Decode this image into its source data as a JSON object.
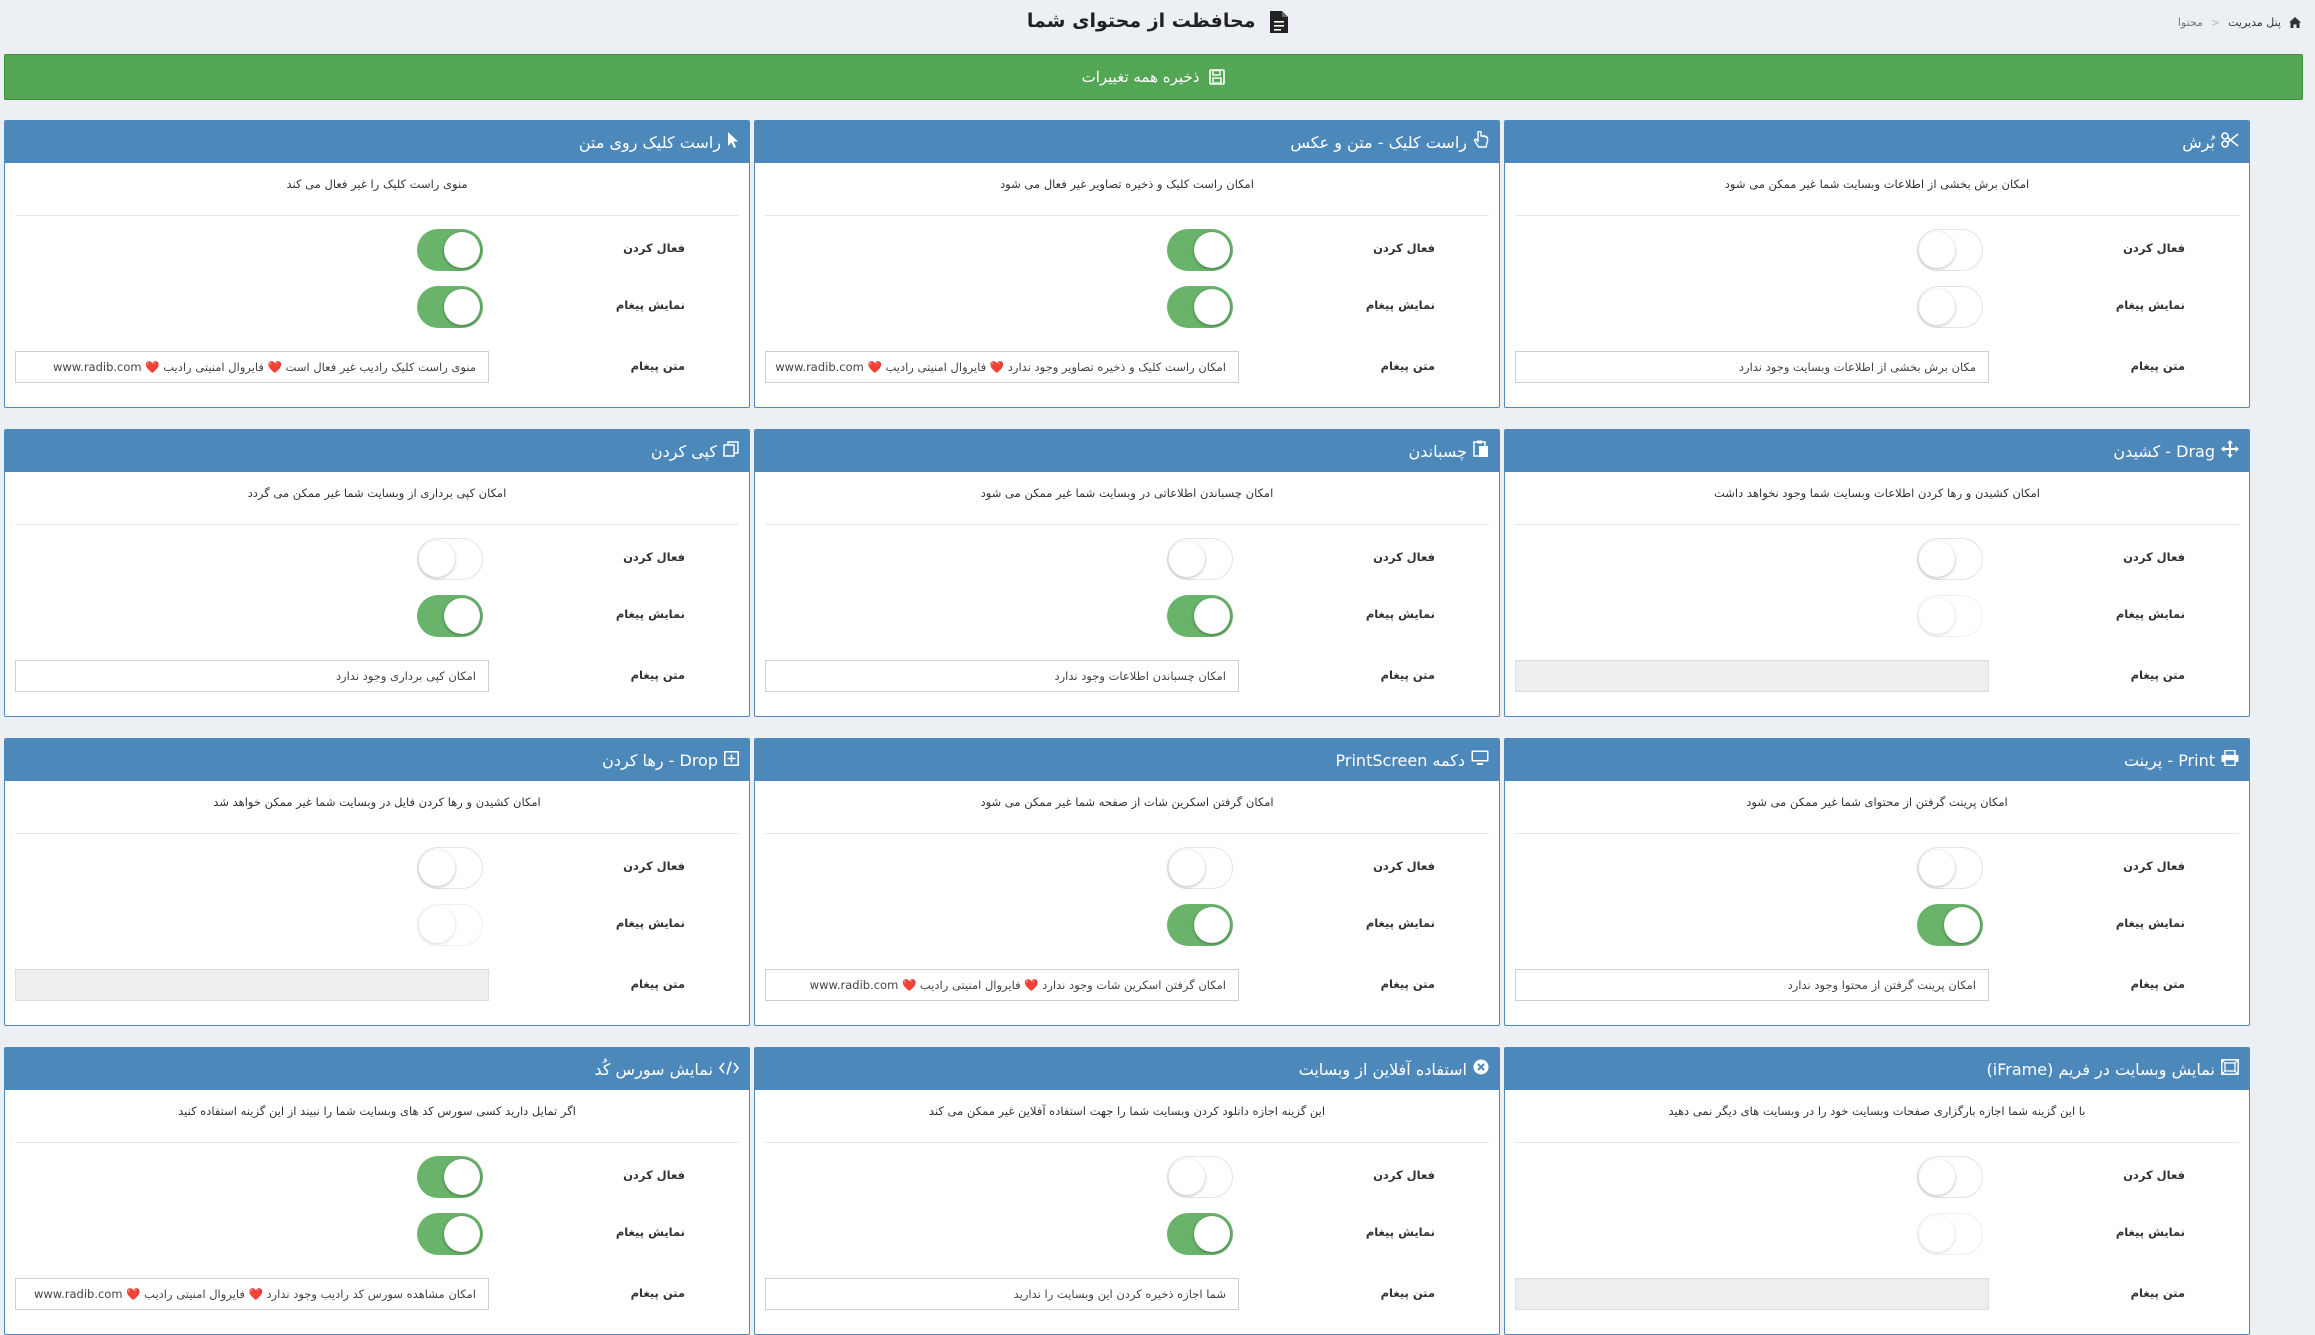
{
  "breadcrumb": {
    "home": "پنل مدیریت",
    "current": "محتوا"
  },
  "page_title": "محافظت از محتوای شما",
  "save_button": "ذخیره همه تغییرات",
  "labels": {
    "enable": "فعال کردن",
    "show_message": "نمایش پیغام",
    "message_text": "متن پیغام"
  },
  "colors": {
    "header": "#4d88bb",
    "save": "#53a653",
    "toggle_on": "#69b36b"
  },
  "cards": [
    {
      "title": "بُرش",
      "icon": "scissors-icon",
      "desc": "امکان برش بخشی از اطلاعات وبسایت شما غیر ممکن می شود",
      "enable": false,
      "show": false,
      "message": "مکان برش بخشی از اطلاعات وبسایت وجود ندارد",
      "disabled": false
    },
    {
      "title": "راست کلیک - متن و عکس",
      "icon": "hand-pointer-icon",
      "desc": "امکان راست کلیک و ذخیره تصاویر غیر فعال می شود",
      "enable": true,
      "show": true,
      "message": "امکان راست کلیک و ذخیره تصاویر وجود ندارد ❤️ فایروال امنیتی رادیب ❤️ www.radib.com",
      "disabled": false
    },
    {
      "title": "راست کلیک روی متن",
      "icon": "cursor-icon",
      "desc": "منوی راست کلیک را غیر فعال می کند",
      "enable": true,
      "show": true,
      "message": "منوی راست کلیک رادیب غیر فعال است ❤️ فایروال امنیتی رادیب ❤️ www.radib.com",
      "disabled": false
    },
    {
      "title": "Drag - کشیدن",
      "icon": "move-icon",
      "desc": "امکان کشیدن و رها کردن اطلاعات وبسایت شما وجود نخواهد داشت",
      "enable": false,
      "show": false,
      "message": "",
      "disabled": true
    },
    {
      "title": "چسباندن",
      "icon": "paste-icon",
      "desc": "امکان چسباندن اطلاعاتی در وبسایت شما غیر ممکن می شود",
      "enable": false,
      "show": true,
      "message": "امکان چسباندن اطلاعات وجود ندارد",
      "disabled": false
    },
    {
      "title": "کپی کردن",
      "icon": "copy-icon",
      "desc": "امکان کپی برداری از وبسایت شما غیر ممکن می گردد",
      "enable": false,
      "show": true,
      "message": "امکان کپی برداری وجود ندارد",
      "disabled": false
    },
    {
      "title": "Print - پرینت",
      "icon": "printer-icon",
      "desc": "امکان پرینت گرفتن از محتوای شما غیر ممکن می شود",
      "enable": false,
      "show": true,
      "message": "امکان پرینت گرفتن از محتوا وجود ندارد",
      "disabled": false
    },
    {
      "title": "دکمه PrintScreen",
      "icon": "monitor-icon",
      "desc": "امکان گرفتن اسکرین شات از صفحه شما غیر ممکن می شود",
      "enable": false,
      "show": true,
      "message": "امکان گرفتن اسکرین شات وجود ندارد ❤️ فایروال امنیتی رادیب ❤️ www.radib.com",
      "disabled": false
    },
    {
      "title": "Drop - رها کردن",
      "icon": "plus-square-icon",
      "desc": "امکان کشیدن و رها کردن فایل در وبسایت شما غیر ممکن خواهد شد",
      "enable": false,
      "show": false,
      "message": "",
      "disabled": true
    },
    {
      "title": "نمایش وبسایت در فریم (iFrame)",
      "icon": "frame-icon",
      "desc": "با این گزینه شما اجازه بارگزاری صفحات وبسایت خود را در وبسایت های دیگر نمی دهید",
      "enable": false,
      "show": false,
      "message": "",
      "disabled": true
    },
    {
      "title": "استفاده آفلاین از وبسایت",
      "icon": "close-circle-icon",
      "desc": "این گزینه اجازه دانلود کردن وبسایت شما را جهت استفاده آفلاین غیر ممکن می کند",
      "enable": false,
      "show": true,
      "message": "شما اجازه ذخیره کردن این وبسایت را ندارید",
      "disabled": false
    },
    {
      "title": "نمایش سورس کُد",
      "icon": "code-icon",
      "desc": "اگر تمایل دارید کسی سورس کد های وبسایت شما را نبیند از این گزینه استفاده کنید",
      "enable": true,
      "show": true,
      "message": "امکان مشاهده سورس کد رادیب وجود ندارد ❤️ فایروال امنیتی رادیب ❤️ www.radib.com",
      "disabled": false
    }
  ]
}
